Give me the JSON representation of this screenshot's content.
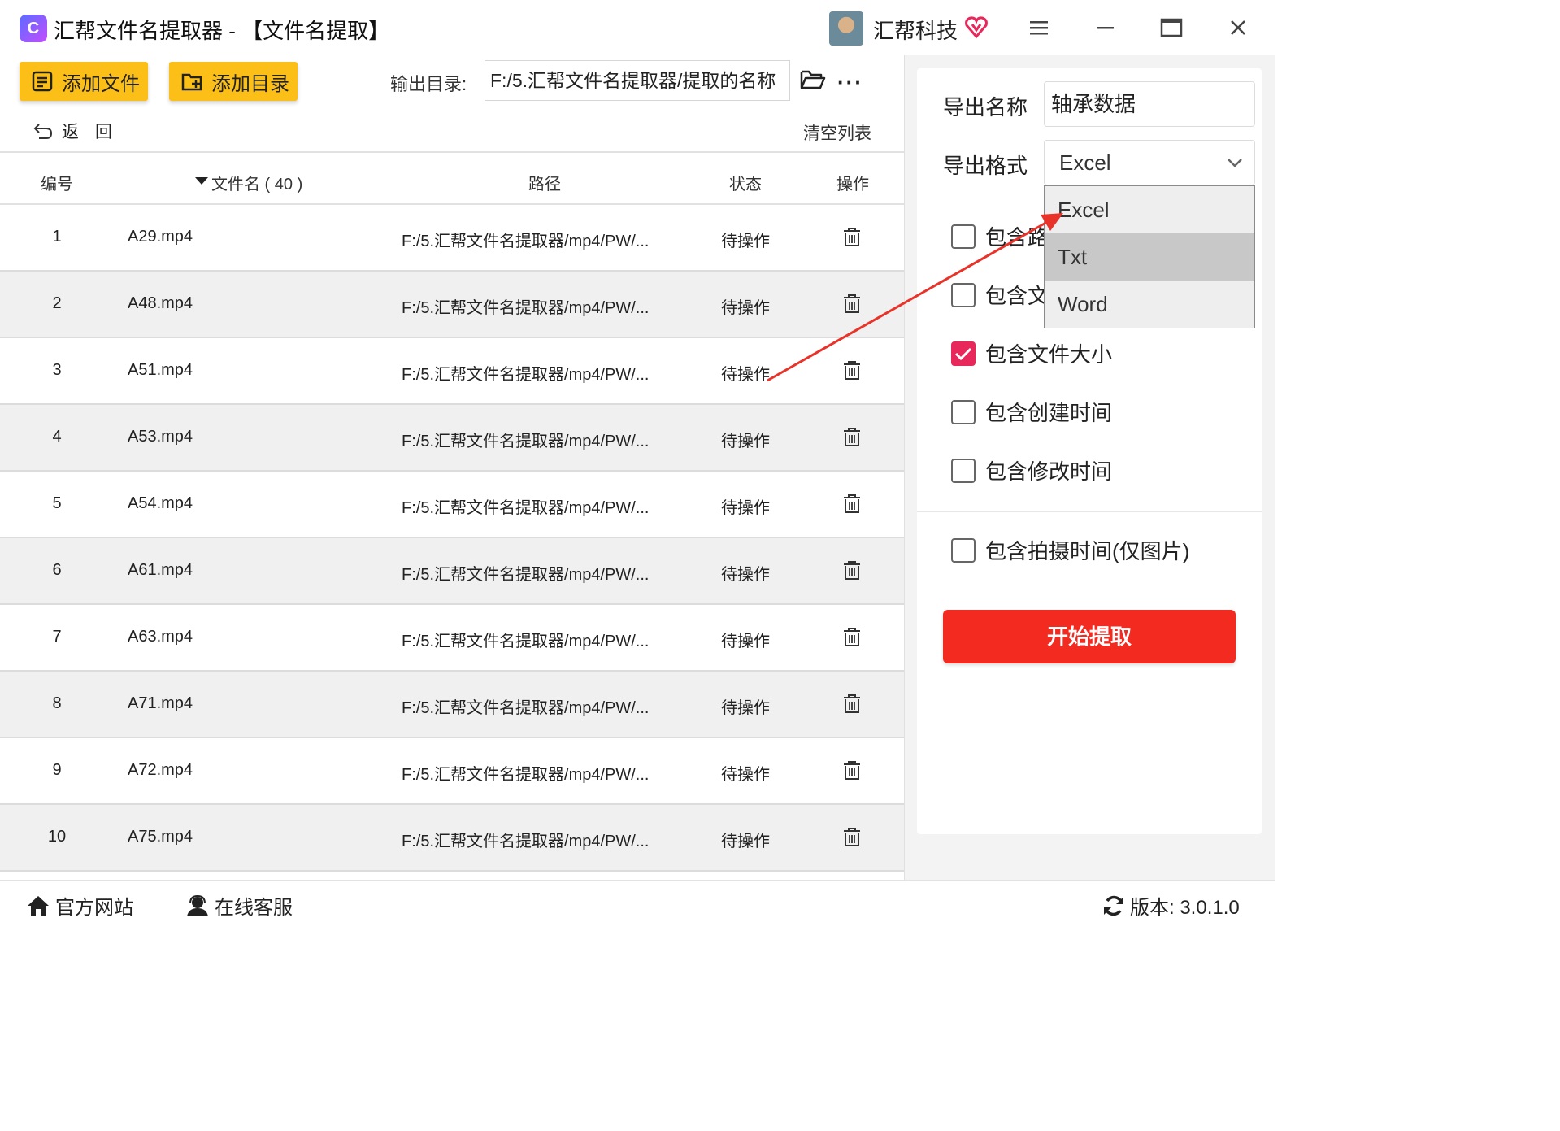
{
  "titlebar": {
    "logo_char": "C",
    "title": "汇帮文件名提取器 - 【文件名提取】",
    "company": "汇帮科技"
  },
  "toolbar": {
    "add_file": "添加文件",
    "add_dir": "添加目录",
    "output_label": "输出目录:",
    "output_path": "F:/5.汇帮文件名提取器/提取的名称",
    "more": "···",
    "back": "返回",
    "clear": "清空列表"
  },
  "table": {
    "headers": {
      "no": "编号",
      "name": "文件名 ( 40 )",
      "path": "路径",
      "status": "状态",
      "op": "操作"
    },
    "rows": [
      {
        "no": "1",
        "name": "A29.mp4",
        "path": "F:/5.汇帮文件名提取器/mp4/PW/...",
        "status": "待操作"
      },
      {
        "no": "2",
        "name": "A48.mp4",
        "path": "F:/5.汇帮文件名提取器/mp4/PW/...",
        "status": "待操作"
      },
      {
        "no": "3",
        "name": "A51.mp4",
        "path": "F:/5.汇帮文件名提取器/mp4/PW/...",
        "status": "待操作"
      },
      {
        "no": "4",
        "name": "A53.mp4",
        "path": "F:/5.汇帮文件名提取器/mp4/PW/...",
        "status": "待操作"
      },
      {
        "no": "5",
        "name": "A54.mp4",
        "path": "F:/5.汇帮文件名提取器/mp4/PW/...",
        "status": "待操作"
      },
      {
        "no": "6",
        "name": "A61.mp4",
        "path": "F:/5.汇帮文件名提取器/mp4/PW/...",
        "status": "待操作"
      },
      {
        "no": "7",
        "name": "A63.mp4",
        "path": "F:/5.汇帮文件名提取器/mp4/PW/...",
        "status": "待操作"
      },
      {
        "no": "8",
        "name": "A71.mp4",
        "path": "F:/5.汇帮文件名提取器/mp4/PW/...",
        "status": "待操作"
      },
      {
        "no": "9",
        "name": "A72.mp4",
        "path": "F:/5.汇帮文件名提取器/mp4/PW/...",
        "status": "待操作"
      },
      {
        "no": "10",
        "name": "A75.mp4",
        "path": "F:/5.汇帮文件名提取器/mp4/PW/...",
        "status": "待操作"
      }
    ]
  },
  "settings": {
    "export_name_label": "导出名称",
    "export_name_value": "轴承数据",
    "export_format_label": "导出格式",
    "export_format_value": "Excel",
    "format_options": [
      "Excel",
      "Txt",
      "Word"
    ],
    "options": [
      {
        "label": "包含路",
        "checked": false
      },
      {
        "label": "包含文",
        "checked": false
      },
      {
        "label": "包含文件大小",
        "checked": true
      },
      {
        "label": "包含创建时间",
        "checked": false
      },
      {
        "label": "包含修改时间",
        "checked": false
      },
      {
        "label": "包含拍摄时间(仅图片)",
        "checked": false
      }
    ],
    "start": "开始提取"
  },
  "footer": {
    "website": "官方网站",
    "support": "在线客服",
    "version": "版本:  3.0.1.0"
  },
  "colors": {
    "accent_yellow": "#fcbf17",
    "start_red": "#f22a1f",
    "check_pink": "#e8285a",
    "arrow_red": "#e8332a"
  },
  "icons": [
    "app-logo-icon",
    "vip-heart-icon",
    "menu-icon",
    "minimize-icon",
    "maximize-icon",
    "close-icon",
    "add-file-icon",
    "add-folder-icon",
    "folder-open-icon",
    "back-icon",
    "sort-down-icon",
    "trash-icon",
    "chevron-down-icon",
    "home-icon",
    "user-support-icon",
    "refresh-icon"
  ]
}
